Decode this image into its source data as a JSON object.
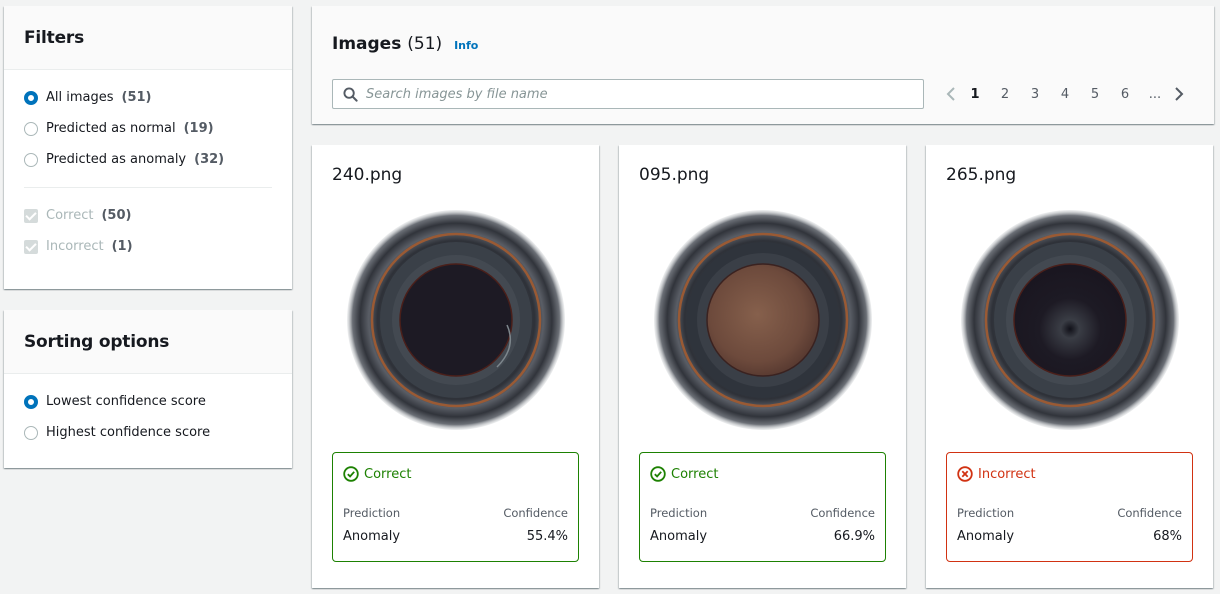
{
  "filters": {
    "title": "Filters",
    "prediction_options": [
      {
        "label": "All images",
        "count": "(51)",
        "selected": true
      },
      {
        "label": "Predicted as normal",
        "count": "(19)",
        "selected": false
      },
      {
        "label": "Predicted as anomaly",
        "count": "(32)",
        "selected": false
      }
    ],
    "result_options": [
      {
        "label": "Correct",
        "count": "(50)",
        "checked": true,
        "disabled": true
      },
      {
        "label": "Incorrect",
        "count": "(1)",
        "checked": true,
        "disabled": true
      }
    ]
  },
  "sorting": {
    "title": "Sorting options",
    "options": [
      {
        "label": "Lowest confidence score",
        "selected": true
      },
      {
        "label": "Highest confidence score",
        "selected": false
      }
    ]
  },
  "images_header": {
    "title": "Images",
    "count": "(51)",
    "info_label": "Info",
    "search_placeholder": "Search images by file name",
    "search_value": "",
    "pages": [
      "1",
      "2",
      "3",
      "4",
      "5",
      "6",
      "..."
    ],
    "current_page": "1"
  },
  "colors": {
    "accent": "#0073bb",
    "correct": "#1d8102",
    "incorrect": "#d13212"
  },
  "cards": [
    {
      "file_name": "240.png",
      "status": "Correct",
      "prediction_label": "Prediction",
      "prediction": "Anomaly",
      "confidence_label": "Confidence",
      "confidence": "55.4%",
      "image_variant": "dark-center-chipped"
    },
    {
      "file_name": "095.png",
      "status": "Correct",
      "prediction_label": "Prediction",
      "prediction": "Anomaly",
      "confidence_label": "Confidence",
      "confidence": "66.9%",
      "image_variant": "brown-center"
    },
    {
      "file_name": "265.png",
      "status": "Incorrect",
      "prediction_label": "Prediction",
      "prediction": "Anomaly",
      "confidence_label": "Confidence",
      "confidence": "68%",
      "image_variant": "dark-center"
    }
  ]
}
